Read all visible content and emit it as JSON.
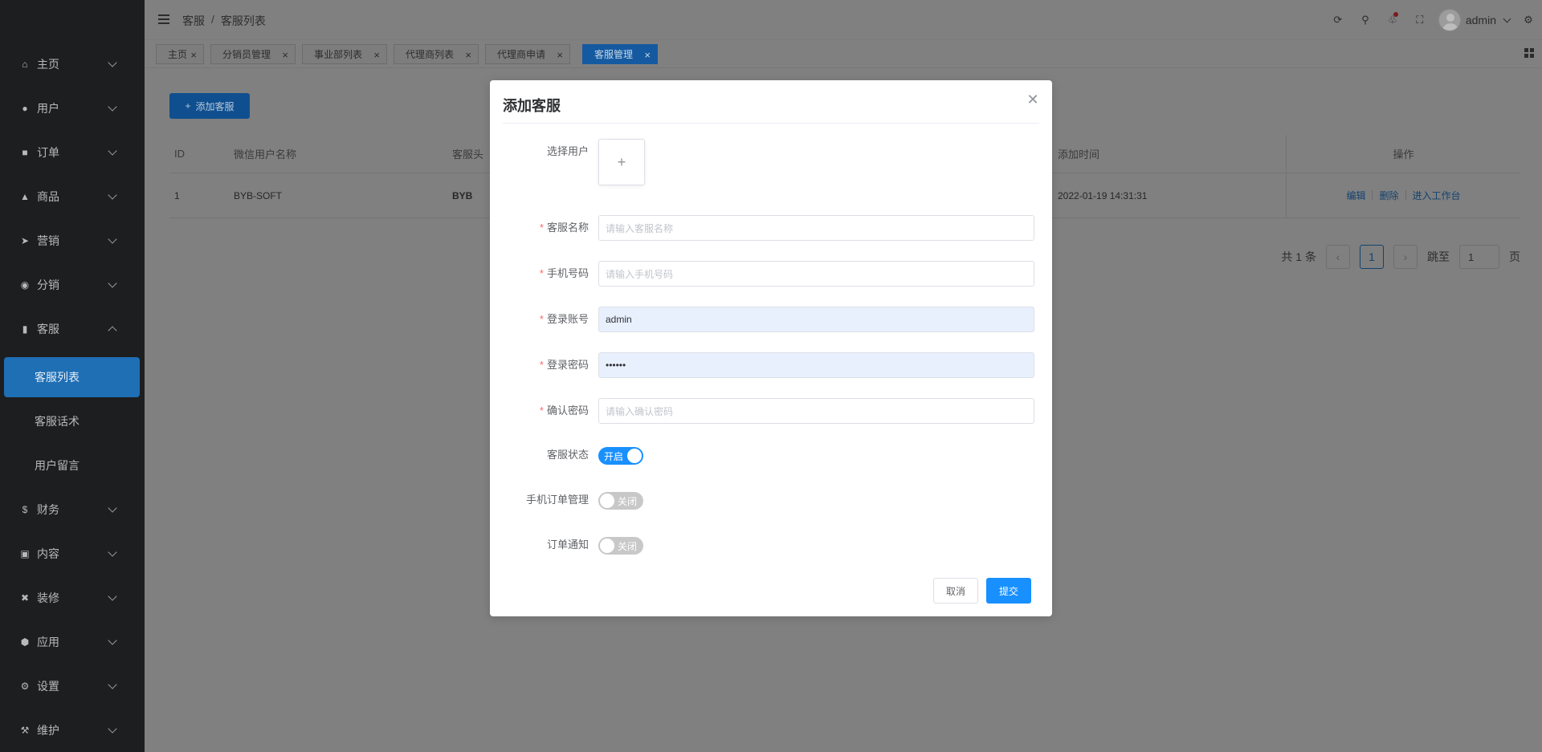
{
  "sidebar": {
    "items": [
      {
        "label": "主页",
        "icon": "home-icon"
      },
      {
        "label": "用户",
        "icon": "user-icon"
      },
      {
        "label": "订单",
        "icon": "cart-icon"
      },
      {
        "label": "商品",
        "icon": "bag-icon"
      },
      {
        "label": "营销",
        "icon": "send-icon"
      },
      {
        "label": "分销",
        "icon": "share-icon"
      },
      {
        "label": "客服",
        "icon": "chat-icon"
      },
      {
        "label": "财务",
        "icon": "dollar-icon"
      },
      {
        "label": "内容",
        "icon": "book-icon"
      },
      {
        "label": "装修",
        "icon": "tools-icon"
      },
      {
        "label": "应用",
        "icon": "app-icon"
      },
      {
        "label": "设置",
        "icon": "gear-icon"
      },
      {
        "label": "维护",
        "icon": "hammer-icon"
      }
    ],
    "sub_items": [
      {
        "label": "客服列表"
      },
      {
        "label": "客服话术"
      },
      {
        "label": "用户留言"
      }
    ]
  },
  "header": {
    "breadcrumb": [
      "客服",
      "客服列表"
    ],
    "breadcrumb_sep": "/",
    "username": "admin"
  },
  "tabs": [
    {
      "label": "主页"
    },
    {
      "label": "分销员管理"
    },
    {
      "label": "事业部列表"
    },
    {
      "label": "代理商列表"
    },
    {
      "label": "代理商申请"
    },
    {
      "label": "客服管理"
    }
  ],
  "main": {
    "add_button": "添加客服",
    "columns": {
      "id": "ID",
      "wechat_name": "微信用户名称",
      "avatar": "客服头",
      "add_time": "添加时间",
      "actions": "操作"
    },
    "rows": [
      {
        "id": "1",
        "wechat_name": "BYB-SOFT",
        "avatar": "BYB",
        "add_time": "2022-01-19 14:31:31"
      }
    ],
    "row_actions": [
      "编辑",
      "删除",
      "进入工作台"
    ],
    "pagination": {
      "total_text": "共 1 条",
      "current_page": "1",
      "jump_label": "跳至",
      "jump_value": "1",
      "page_suffix": "页"
    }
  },
  "modal": {
    "title": "添加客服",
    "fields": {
      "select_user": {
        "label": "选择用户"
      },
      "name": {
        "label": "客服名称",
        "placeholder": "请输入客服名称"
      },
      "phone": {
        "label": "手机号码",
        "placeholder": "请输入手机号码"
      },
      "account": {
        "label": "登录账号",
        "value": "admin"
      },
      "password": {
        "label": "登录密码",
        "value": "••••••"
      },
      "confirm": {
        "label": "确认密码",
        "placeholder": "请输入确认密码"
      },
      "status": {
        "label": "客服状态",
        "state": "开启"
      },
      "order_manage": {
        "label": "手机订单管理",
        "state": "关闭"
      },
      "order_notify": {
        "label": "订单通知",
        "state": "关闭"
      }
    },
    "cancel": "取消",
    "submit": "提交"
  },
  "colors": {
    "primary": "#1890ff",
    "required": "#f56c6c",
    "sidebar_bg": "#1d1e1f",
    "sidebar_active": "#1f6fb5"
  }
}
